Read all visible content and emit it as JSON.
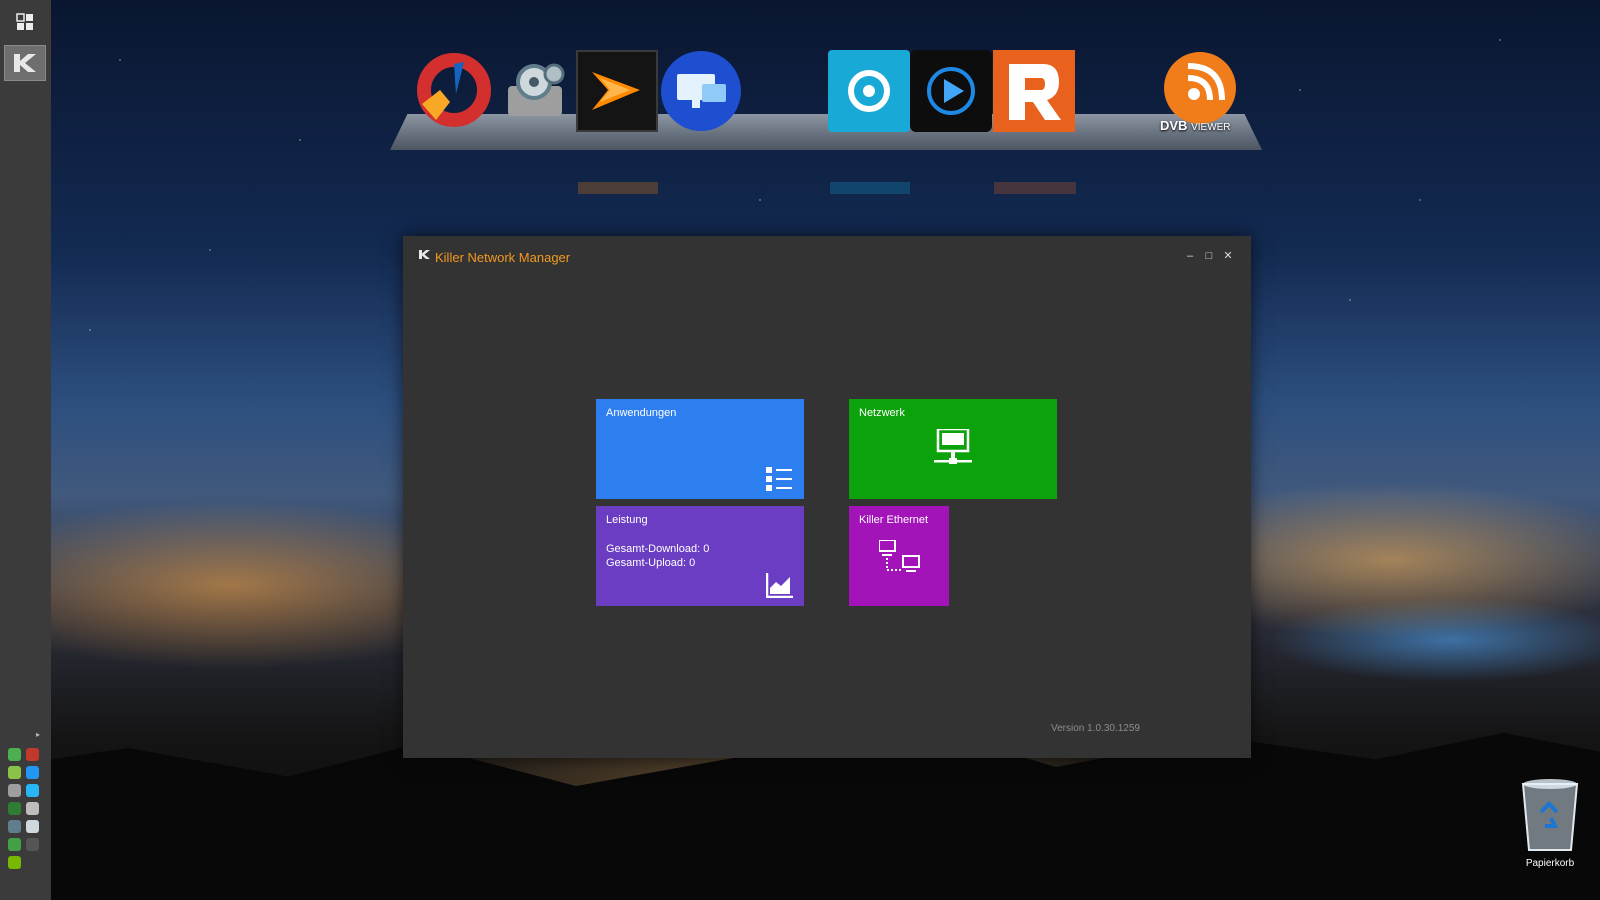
{
  "window": {
    "title": "Killer Network Manager",
    "version": "Version 1.0.30.1259",
    "controls": {
      "minimize": "‒",
      "maximize": "□",
      "close": "✕"
    }
  },
  "tiles": {
    "applications": {
      "title": "Anwendungen",
      "icon": "list-icon",
      "color": "#2d7ff0"
    },
    "network": {
      "title": "Netzwerk",
      "icon": "network-computer-icon",
      "color": "#0ca20c"
    },
    "performance": {
      "title": "Leistung",
      "download_label": "Gesamt-Download: 0",
      "upload_label": "Gesamt-Upload: 0",
      "icon": "chart-icon",
      "color": "#6a3dc3"
    },
    "ethernet": {
      "title": "Killer Ethernet",
      "icon": "ethernet-computers-icon",
      "color": "#a314b8"
    }
  },
  "dock": {
    "items": [
      {
        "name": "ccleaner",
        "icon": "ccleaner-icon"
      },
      {
        "name": "driver-tool",
        "icon": "gears-icon"
      },
      {
        "name": "razer-cortex",
        "icon": "razer-cortex-icon"
      },
      {
        "name": "remote-desktop",
        "icon": "remote-desktop-icon"
      },
      {
        "name": "photo-app",
        "icon": "aperture-icon"
      },
      {
        "name": "media-player",
        "icon": "play-icon"
      },
      {
        "name": "r-app",
        "icon": "r-logo-icon"
      },
      {
        "name": "dvbviewer",
        "icon": "dvbviewer-icon"
      }
    ],
    "dvb_brand": "DVB",
    "dvb_sub": "VIEWER"
  },
  "desktop": {
    "recycle_bin_label": "Papierkorb"
  },
  "sidebar": {
    "top_icon": "apps-grid-icon",
    "app_icon": "killer-k-icon",
    "tray_arrow": "▸"
  },
  "colors": {
    "accent": "#f39a1f",
    "window_bg": "#333333",
    "sidebar_bg": "#3b3b3b"
  }
}
